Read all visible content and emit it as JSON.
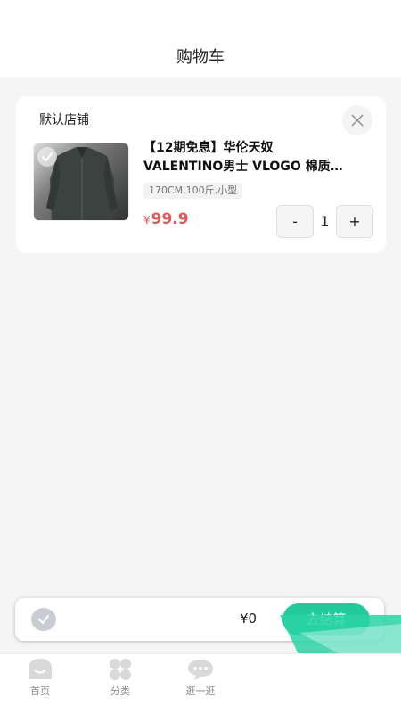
{
  "header": {
    "title": "购物车"
  },
  "shop": {
    "name": "默认店铺",
    "item": {
      "title_line1": "【12期免息】华伦天奴",
      "title_line2": "VALENTINO男士 VLOGO 棉质…",
      "sku": "170CM,100斤,小型",
      "price_currency": "¥",
      "price_value": "99.9",
      "qty_minus": "-",
      "qty_value": "1",
      "qty_plus": "+"
    }
  },
  "checkout": {
    "total": "¥0",
    "button_label": "去结算"
  },
  "tabbar": {
    "home": "首页",
    "category": "分类",
    "browse": "逛一逛"
  },
  "colors": {
    "accent": "#22c99a",
    "price": "#e05a5a"
  }
}
